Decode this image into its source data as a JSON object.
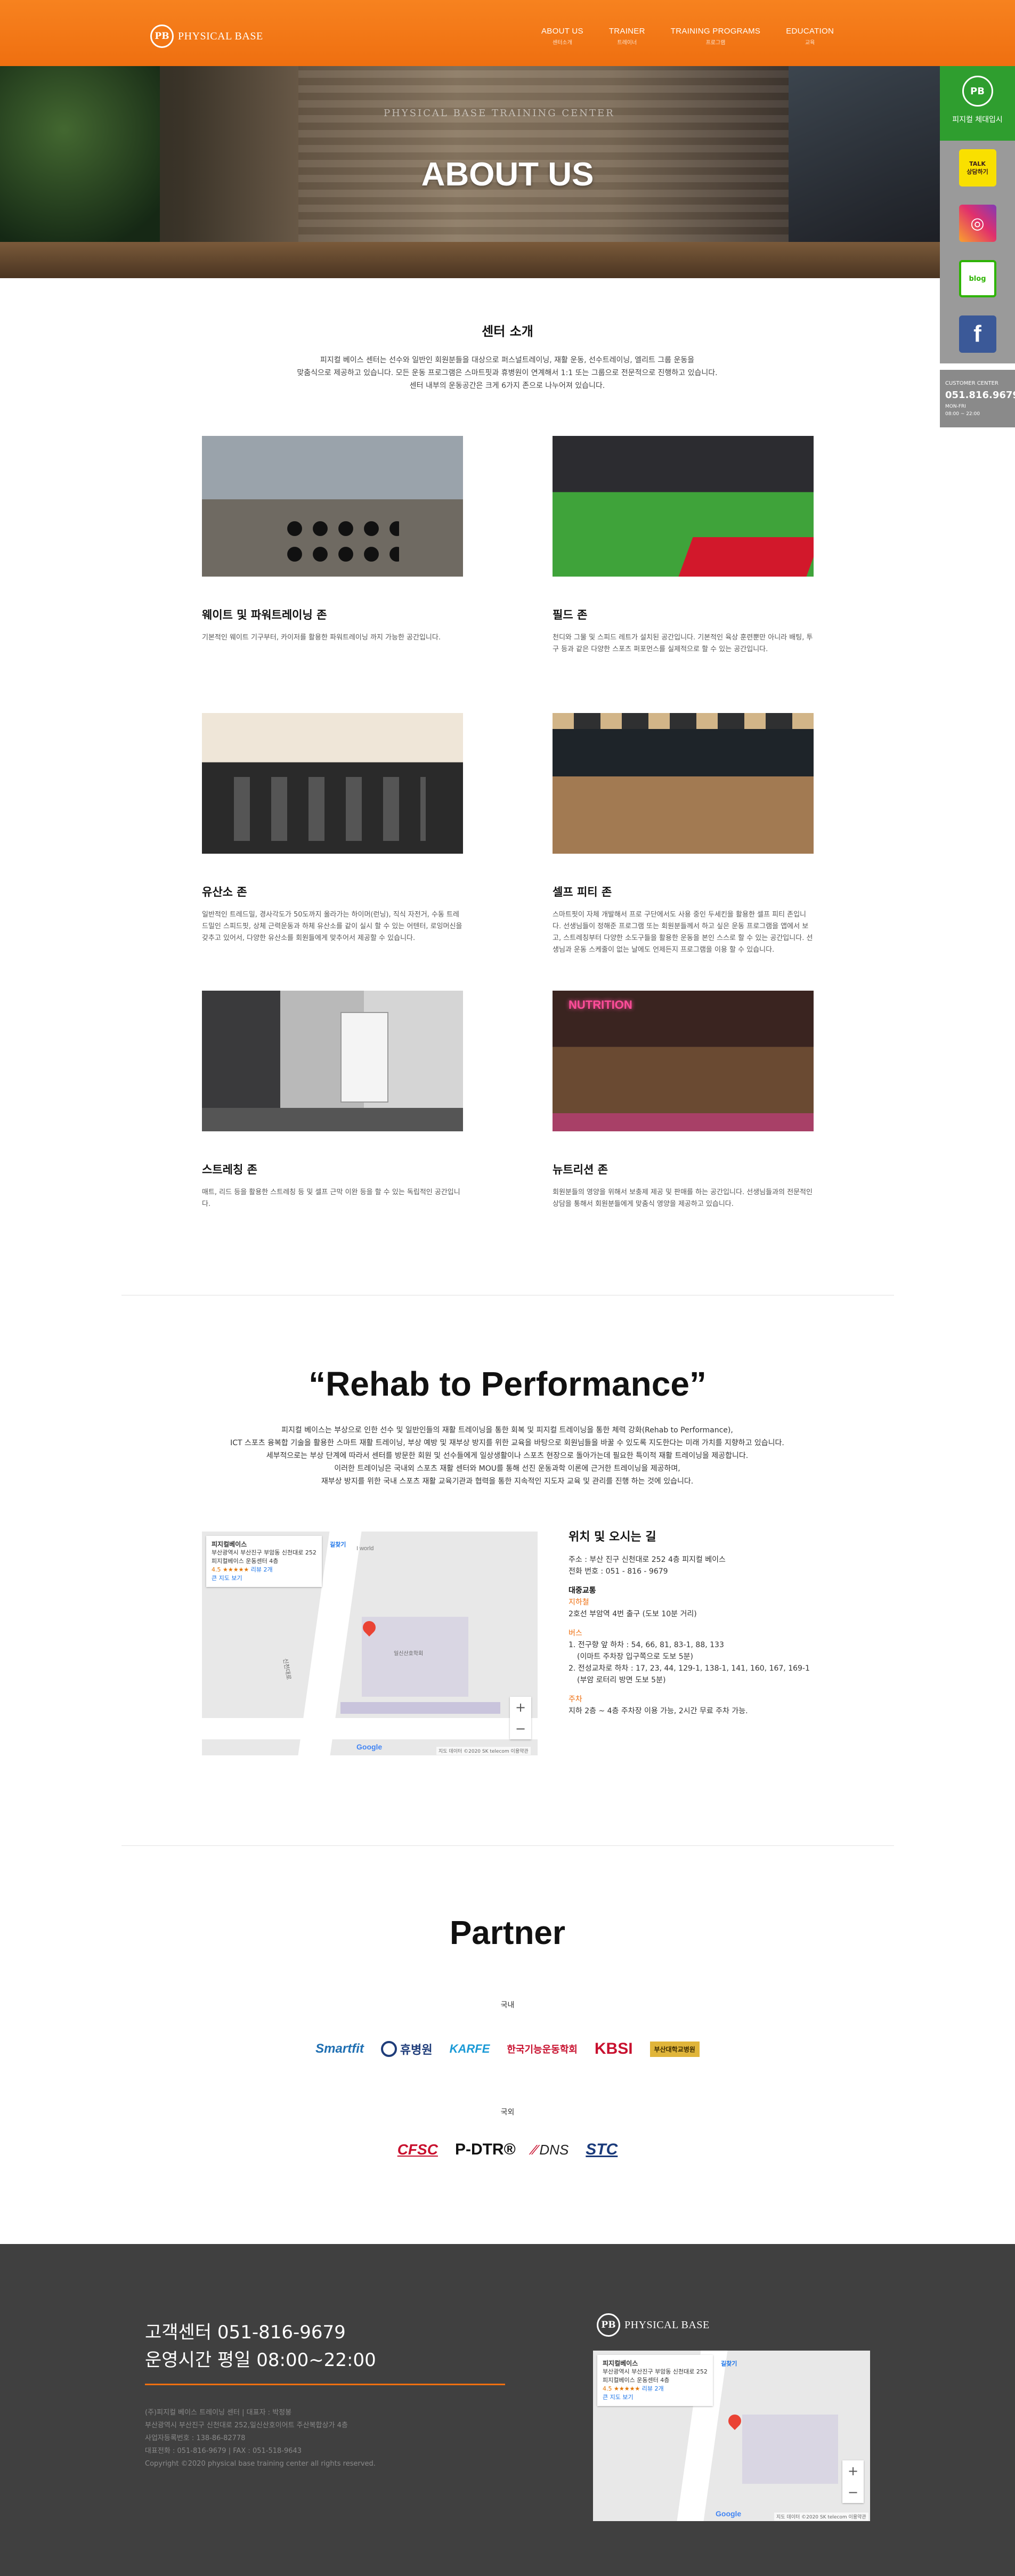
{
  "header": {
    "logo_mark": "PB",
    "logo_text": "PHYSICAL BASE",
    "nav": [
      {
        "en": "ABOUT US",
        "ko": "센터소개"
      },
      {
        "en": "TRAINER",
        "ko": "트레이너"
      },
      {
        "en": "TRAINING PROGRAMS",
        "ko": "프로그램"
      },
      {
        "en": "EDUCATION",
        "ko": "교육"
      }
    ]
  },
  "hero": {
    "title": "ABOUT US",
    "sign": "PHYSICAL BASE TRAINING CENTER"
  },
  "quickbar": {
    "top_mark": "PB",
    "top_label": "피지컬 체대입시",
    "kakao": "TALK\n상담하기",
    "instagram": "◎",
    "blog": "blog",
    "facebook": "f",
    "cs_title": "CUSTOMER CENTER",
    "cs_phone": "051.816.9679",
    "cs_hours1": "MON-FRI",
    "cs_hours2": "08:00 ~ 22:00"
  },
  "intro": {
    "title": "센터 소개",
    "line1": "피지컬 베이스 센터는 선수와 일반인 회원분들을 대상으로 퍼스널트레이닝, 재활 운동, 선수트레이닝, 엘리트 그룹 운동을",
    "line2": "맞춤식으로 제공하고 있습니다. 모든 운동 프로그램은 스마트핏과 휴병원이 연계해서 1:1 또는 그룹으로 전문적으로 진행하고 있습니다.",
    "line3": "센터 내부의 운동공간은 크게 6가지 존으로 나누어져 있습니다."
  },
  "zones": [
    {
      "title": "웨이트 및 파워트레이닝 존",
      "desc": "기본적인 웨이트 기구부터, 카이저를 활용한 파워트레이닝 까지 가능한 공간입니다."
    },
    {
      "title": "필드 존",
      "desc": "천디와 그물 및 스피드 레트가 설치된 공간입니다. 기본적인 육상 훈련뿐만 아니라 배팅, 투구 등과 같은 다양한 스포츠 퍼포먼스를 실제적으로 할 수 있는 공간입니다."
    },
    {
      "title": "유산소 존",
      "desc": "일반적인 트레드밀, 경사각도가 50도까지 올라가는 하이머(런닝), 직식 자전거, 수동 트레드밀인 스피드핏, 상체 근력운동과 하체 유산소를 같이 실시 할 수 있는 어텐터, 로잉머신을 갖추고 있어서, 다양한 유산소를 회원들에게 맞추어서 제공할 수 있습니다."
    },
    {
      "title": "셀프 피티 존",
      "desc": "스마트핏이 자체 개발해서 프로 구단에서도 사용 중인 두세킨을 활용한 셀프 피티 존입니다. 선생님들이 정해준 프로그램 또는 회원분들께서 하고 싶은 운동 프로그램을 앱에서 보고, 스트레칭부터 다양한 소도구들을 활용한 운동을 본인 스스로 할 수 있는 공간입니다. 선생님과 운동 스케줄이 없는 날에도 언제든지 프로그램을 이용 할 수 있습니다."
    },
    {
      "title": "스트레칭 존",
      "desc": "매트, 리드 등을 활용한 스트레칭 등 및 셀프 근막 이완 등을 할 수 있는 독립적인 공간입니다."
    },
    {
      "title": "뉴트리션 존",
      "desc": "회원분들의 영양을 위해서 보충제 제공 및 판매를 하는 공간입니다. 선생님들과의 전문적인 상담을 통해서 회원분들에게 맞춤식 영양을 제공하고 있습니다."
    }
  ],
  "rehab": {
    "quote": "“Rehab to Performance”",
    "line1": "피지컬 베이스는 부상으로 인한 선수 및 일반인들의 재활 트레이닝을 통한 회복 및 피지컬 트레이닝을 통한 체력 강화(Rehab to Performance),",
    "line2": "ICT 스포츠 융복합 기술을 활용한 스마트 재활 트레이닝, 부상 예방 및 재부상 방지를 위한 교육을 바탕으로 회원님들을 바꿀 수 있도록 지도한다는 미래 가치를 지향하고 있습니다.",
    "line3": "세부적으로는 부상 단계에 따라서 센터를 방문한 회원 및 선수들에게 일상생활이나 스포츠 현장으로 돌아가는데 필요한 특이적 재활 트레이닝을 제공합니다.",
    "line4": "이러한 트레이닝은 국내외 스포츠 재활 센터와 MOU를 통해 선진 운동과학 이론에 근거한 트레이닝을 제공하며,",
    "line5": "재부상 방지를 위한 국내 스포츠 재활 교육기관과 협력을 통한 지속적인 지도자 교육 및 관리를 진행 하는 것에 있습니다."
  },
  "map": {
    "place": "피지컬베이스",
    "addr1": "부산광역시 부산진구 부암동 신천대로 252",
    "addr2": "피지컬베이스 운동센터 4층",
    "rating": "4.5 ★★★★★",
    "reviews": "리뷰 2개",
    "larger": "큰 지도 보기",
    "directions": "길찾기",
    "zoom_in": "+",
    "zoom_out": "−",
    "attrib": "지도 데이터 ©2020 SK telecom   이용약관",
    "google": "Google",
    "road_label": "신천대로",
    "bldg": "일신산호학회",
    "world": "I world"
  },
  "directions": {
    "title": "위치 및 오시는 길",
    "address": "주소 : 부산 진구 신천대로 252 4층 피지컬 베이스",
    "phone": "전화 번호 : 051 - 816 - 9679",
    "transit": "대중교통",
    "subway_label": "지하철",
    "subway": "2호선 부암역 4번 출구 (도보 10분 거리)",
    "bus_label": "버스",
    "bus1": "1. 전구향 앞 하차 : 54, 66, 81, 83-1, 88, 133",
    "bus1b": "(이마트 주차장 입구쪽으로 도보 5분)",
    "bus2": "2. 전성교차로 하차 : 17, 23, 44, 129-1, 138-1, 141, 160, 167, 169-1",
    "bus2b": "(부암 로터리 방면 도보 5분)",
    "parking_label": "주차",
    "parking": "지하 2층 ~ 4층 주차장 이용 가능, 2시간 무료 주차 가능."
  },
  "partner": {
    "title": "Partner",
    "domestic": "국내",
    "foreign": "국외",
    "domestic_logos": [
      "Smartfit",
      "휴병원",
      "KARFE",
      "한국기능운동학회",
      "KBSI",
      "부산대학교병원"
    ],
    "foreign_logos": [
      "CFSC",
      "P-DTR®",
      "DNS",
      "STC"
    ]
  },
  "footer": {
    "cs": "고객센터 051-816-9679",
    "hours": "운영시간 평일 08:00~22:00",
    "info1": "(주)피지컬 베이스 트레이닝 센터 | 대표자 : 박정봉",
    "info2": "부산광역시 부산진구 신천대로 252,일신산호이어트 주산복합상가 4층",
    "info3": "사업자등록번호 : 138-86-82778",
    "info4": "대표전화 : 051-816-9679 | FAX : 051-518-9643",
    "info5": "Copyright ©2020 physical base training center all rights reserved.",
    "logo_mark": "PB",
    "logo_text": "PHYSICAL BASE"
  }
}
